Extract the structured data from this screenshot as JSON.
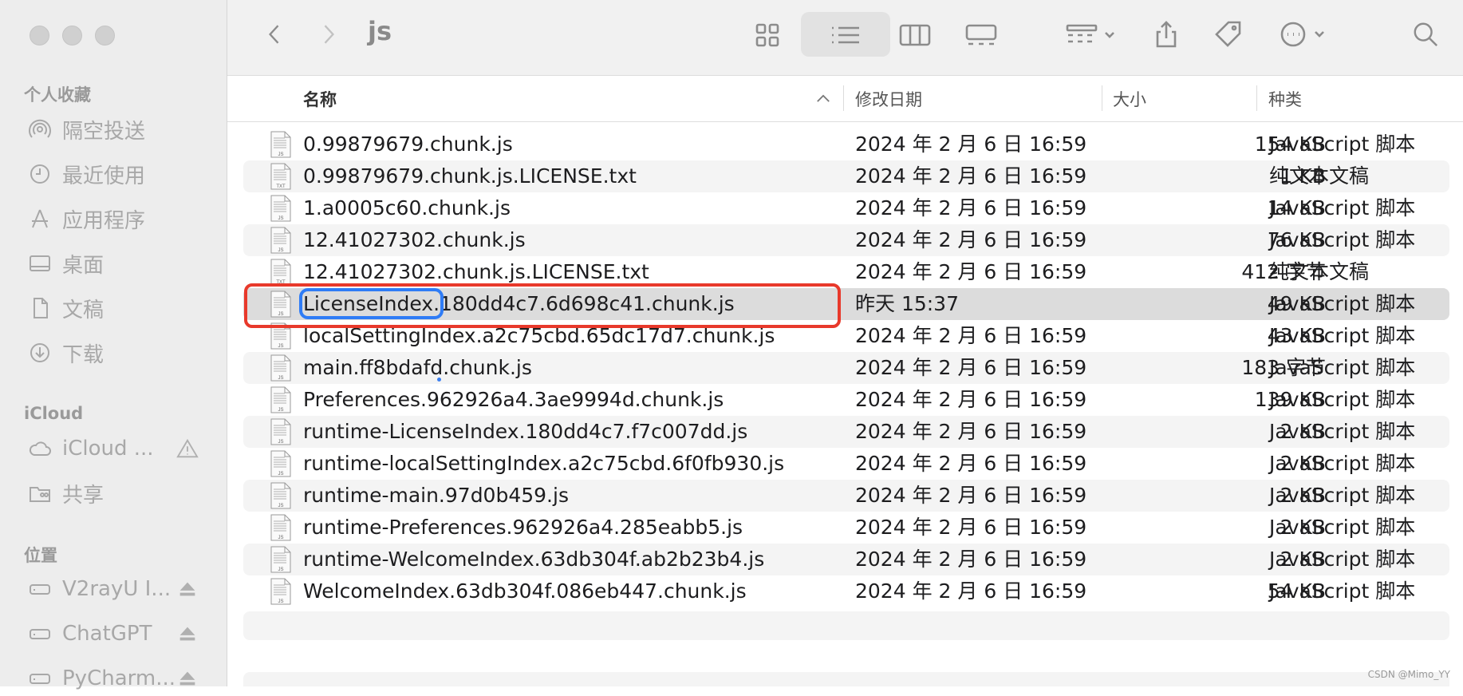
{
  "window": {
    "title": "js"
  },
  "sidebar": {
    "favorites_heading": "个人收藏",
    "favorites": [
      {
        "label": "隔空投送",
        "icon": "airdrop-icon"
      },
      {
        "label": "最近使用",
        "icon": "clock-icon"
      },
      {
        "label": "应用程序",
        "icon": "apps-icon"
      },
      {
        "label": "桌面",
        "icon": "desktop-icon"
      },
      {
        "label": "文稿",
        "icon": "document-icon"
      },
      {
        "label": "下载",
        "icon": "download-icon"
      }
    ],
    "icloud_heading": "iCloud",
    "icloud": [
      {
        "label": "iCloud ...",
        "icon": "cloud-icon",
        "trail": "warning-icon"
      },
      {
        "label": "共享",
        "icon": "shared-folder-icon"
      }
    ],
    "locations_heading": "位置",
    "locations": [
      {
        "label": "V2rayU I...",
        "icon": "drive-icon",
        "trail": "eject-icon"
      },
      {
        "label": "ChatGPT",
        "icon": "drive-icon",
        "trail": "eject-icon"
      },
      {
        "label": "PyCharm...",
        "icon": "drive-icon",
        "trail": "eject-icon"
      }
    ]
  },
  "columns": {
    "name": "名称",
    "date": "修改日期",
    "size": "大小",
    "kind": "种类"
  },
  "files": [
    {
      "name": "0.99879679.chunk.js",
      "date": "2024 年 2 月 6 日 16:59",
      "size": "154 KB",
      "kind": "JavaScript 脚本",
      "type": "js"
    },
    {
      "name": "0.99879679.chunk.js.LICENSE.txt",
      "date": "2024 年 2 月 6 日 16:59",
      "size": "1 KB",
      "kind": "纯文本文稿",
      "type": "txt"
    },
    {
      "name": "1.a0005c60.chunk.js",
      "date": "2024 年 2 月 6 日 16:59",
      "size": "14 KB",
      "kind": "JavaScript 脚本",
      "type": "js"
    },
    {
      "name": "12.41027302.chunk.js",
      "date": "2024 年 2 月 6 日 16:59",
      "size": "76 KB",
      "kind": "JavaScript 脚本",
      "type": "js"
    },
    {
      "name": "12.41027302.chunk.js.LICENSE.txt",
      "date": "2024 年 2 月 6 日 16:59",
      "size": "412 字节",
      "kind": "纯文本文稿",
      "type": "txt"
    },
    {
      "name_part1": "LicenseIndex.",
      "name_part2": "180dd4c7.6d698c41.chunk.js",
      "date": "昨天 15:37",
      "size": "49 KB",
      "kind": "JavaScript 脚本",
      "type": "js",
      "selected": true
    },
    {
      "name": "localSettingIndex.a2c75cbd.65dc17d7.chunk.js",
      "date": "2024 年 2 月 6 日 16:59",
      "size": "43 KB",
      "kind": "JavaScript 脚本",
      "type": "js"
    },
    {
      "name": "main.ff8bdafd.chunk.js",
      "date": "2024 年 2 月 6 日 16:59",
      "size": "183 字节",
      "kind": "JavaScript 脚本",
      "type": "js"
    },
    {
      "name": "Preferences.962926a4.3ae9994d.chunk.js",
      "date": "2024 年 2 月 6 日 16:59",
      "size": "139 KB",
      "kind": "JavaScript 脚本",
      "type": "js"
    },
    {
      "name": "runtime-LicenseIndex.180dd4c7.f7c007dd.js",
      "date": "2024 年 2 月 6 日 16:59",
      "size": "2 KB",
      "kind": "JavaScript 脚本",
      "type": "js"
    },
    {
      "name": "runtime-localSettingIndex.a2c75cbd.6f0fb930.js",
      "date": "2024 年 2 月 6 日 16:59",
      "size": "2 KB",
      "kind": "JavaScript 脚本",
      "type": "js"
    },
    {
      "name": "runtime-main.97d0b459.js",
      "date": "2024 年 2 月 6 日 16:59",
      "size": "2 KB",
      "kind": "JavaScript 脚本",
      "type": "js"
    },
    {
      "name": "runtime-Preferences.962926a4.285eabb5.js",
      "date": "2024 年 2 月 6 日 16:59",
      "size": "2 KB",
      "kind": "JavaScript 脚本",
      "type": "js"
    },
    {
      "name": "runtime-WelcomeIndex.63db304f.ab2b23b4.js",
      "date": "2024 年 2 月 6 日 16:59",
      "size": "2 KB",
      "kind": "JavaScript 脚本",
      "type": "js"
    },
    {
      "name": "WelcomeIndex.63db304f.086eb447.chunk.js",
      "date": "2024 年 2 月 6 日 16:59",
      "size": "54 KB",
      "kind": "JavaScript 脚本",
      "type": "js"
    }
  ],
  "file_icon_labels": {
    "js": "JS",
    "txt": "TXT"
  },
  "watermark": "CSDN @Mimo_YY",
  "colors": {
    "selection_outline": "#2f7cf6",
    "annotation_box": "#e8392b",
    "sidebar_bg": "#ededed"
  }
}
